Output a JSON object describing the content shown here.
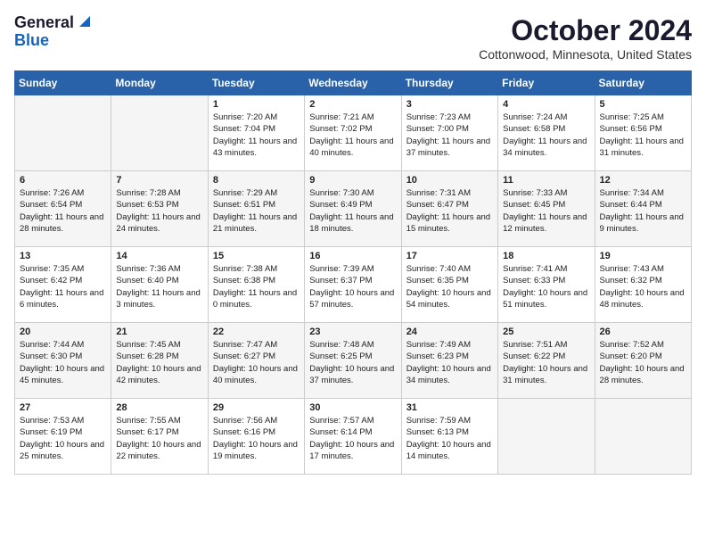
{
  "header": {
    "logo_general": "General",
    "logo_blue": "Blue",
    "month_title": "October 2024",
    "location": "Cottonwood, Minnesota, United States"
  },
  "days_of_week": [
    "Sunday",
    "Monday",
    "Tuesday",
    "Wednesday",
    "Thursday",
    "Friday",
    "Saturday"
  ],
  "weeks": [
    [
      {
        "day": "",
        "empty": true
      },
      {
        "day": "",
        "empty": true
      },
      {
        "day": "1",
        "sunrise": "7:20 AM",
        "sunset": "7:04 PM",
        "daylight": "11 hours and 43 minutes."
      },
      {
        "day": "2",
        "sunrise": "7:21 AM",
        "sunset": "7:02 PM",
        "daylight": "11 hours and 40 minutes."
      },
      {
        "day": "3",
        "sunrise": "7:23 AM",
        "sunset": "7:00 PM",
        "daylight": "11 hours and 37 minutes."
      },
      {
        "day": "4",
        "sunrise": "7:24 AM",
        "sunset": "6:58 PM",
        "daylight": "11 hours and 34 minutes."
      },
      {
        "day": "5",
        "sunrise": "7:25 AM",
        "sunset": "6:56 PM",
        "daylight": "11 hours and 31 minutes."
      }
    ],
    [
      {
        "day": "6",
        "sunrise": "7:26 AM",
        "sunset": "6:54 PM",
        "daylight": "11 hours and 28 minutes."
      },
      {
        "day": "7",
        "sunrise": "7:28 AM",
        "sunset": "6:53 PM",
        "daylight": "11 hours and 24 minutes."
      },
      {
        "day": "8",
        "sunrise": "7:29 AM",
        "sunset": "6:51 PM",
        "daylight": "11 hours and 21 minutes."
      },
      {
        "day": "9",
        "sunrise": "7:30 AM",
        "sunset": "6:49 PM",
        "daylight": "11 hours and 18 minutes."
      },
      {
        "day": "10",
        "sunrise": "7:31 AM",
        "sunset": "6:47 PM",
        "daylight": "11 hours and 15 minutes."
      },
      {
        "day": "11",
        "sunrise": "7:33 AM",
        "sunset": "6:45 PM",
        "daylight": "11 hours and 12 minutes."
      },
      {
        "day": "12",
        "sunrise": "7:34 AM",
        "sunset": "6:44 PM",
        "daylight": "11 hours and 9 minutes."
      }
    ],
    [
      {
        "day": "13",
        "sunrise": "7:35 AM",
        "sunset": "6:42 PM",
        "daylight": "11 hours and 6 minutes."
      },
      {
        "day": "14",
        "sunrise": "7:36 AM",
        "sunset": "6:40 PM",
        "daylight": "11 hours and 3 minutes."
      },
      {
        "day": "15",
        "sunrise": "7:38 AM",
        "sunset": "6:38 PM",
        "daylight": "11 hours and 0 minutes."
      },
      {
        "day": "16",
        "sunrise": "7:39 AM",
        "sunset": "6:37 PM",
        "daylight": "10 hours and 57 minutes."
      },
      {
        "day": "17",
        "sunrise": "7:40 AM",
        "sunset": "6:35 PM",
        "daylight": "10 hours and 54 minutes."
      },
      {
        "day": "18",
        "sunrise": "7:41 AM",
        "sunset": "6:33 PM",
        "daylight": "10 hours and 51 minutes."
      },
      {
        "day": "19",
        "sunrise": "7:43 AM",
        "sunset": "6:32 PM",
        "daylight": "10 hours and 48 minutes."
      }
    ],
    [
      {
        "day": "20",
        "sunrise": "7:44 AM",
        "sunset": "6:30 PM",
        "daylight": "10 hours and 45 minutes."
      },
      {
        "day": "21",
        "sunrise": "7:45 AM",
        "sunset": "6:28 PM",
        "daylight": "10 hours and 42 minutes."
      },
      {
        "day": "22",
        "sunrise": "7:47 AM",
        "sunset": "6:27 PM",
        "daylight": "10 hours and 40 minutes."
      },
      {
        "day": "23",
        "sunrise": "7:48 AM",
        "sunset": "6:25 PM",
        "daylight": "10 hours and 37 minutes."
      },
      {
        "day": "24",
        "sunrise": "7:49 AM",
        "sunset": "6:23 PM",
        "daylight": "10 hours and 34 minutes."
      },
      {
        "day": "25",
        "sunrise": "7:51 AM",
        "sunset": "6:22 PM",
        "daylight": "10 hours and 31 minutes."
      },
      {
        "day": "26",
        "sunrise": "7:52 AM",
        "sunset": "6:20 PM",
        "daylight": "10 hours and 28 minutes."
      }
    ],
    [
      {
        "day": "27",
        "sunrise": "7:53 AM",
        "sunset": "6:19 PM",
        "daylight": "10 hours and 25 minutes."
      },
      {
        "day": "28",
        "sunrise": "7:55 AM",
        "sunset": "6:17 PM",
        "daylight": "10 hours and 22 minutes."
      },
      {
        "day": "29",
        "sunrise": "7:56 AM",
        "sunset": "6:16 PM",
        "daylight": "10 hours and 19 minutes."
      },
      {
        "day": "30",
        "sunrise": "7:57 AM",
        "sunset": "6:14 PM",
        "daylight": "10 hours and 17 minutes."
      },
      {
        "day": "31",
        "sunrise": "7:59 AM",
        "sunset": "6:13 PM",
        "daylight": "10 hours and 14 minutes."
      },
      {
        "day": "",
        "empty": true
      },
      {
        "day": "",
        "empty": true
      }
    ]
  ],
  "labels": {
    "sunrise_prefix": "Sunrise: ",
    "sunset_prefix": "Sunset: ",
    "daylight_prefix": "Daylight: "
  }
}
